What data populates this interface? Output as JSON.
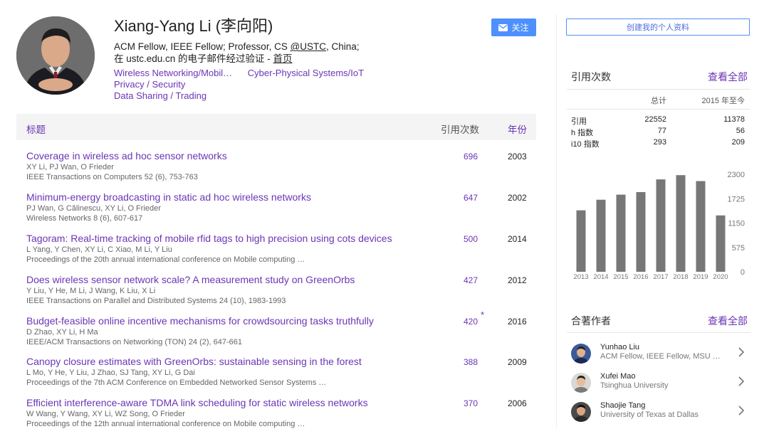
{
  "profile": {
    "name": "Xiang-Yang Li (李向阳)",
    "affiliation_prefix": "ACM Fellow, IEEE Fellow; Professor, CS ",
    "affiliation_org": "@USTC",
    "affiliation_suffix": ", China;",
    "verified_text": "在 ustc.edu.cn 的电子邮件经过验证 - ",
    "homepage_label": "首页",
    "interests": [
      "Wireless Networking/Mobil…",
      "Cyber-Physical Systems/IoT",
      "Privacy / Security",
      "Data Sharing / Trading"
    ]
  },
  "follow_label": "关注",
  "create_profile_label": "创建我的个人资料",
  "table": {
    "header_title": "标题",
    "header_cites": "引用次数",
    "header_year": "年份",
    "articles": [
      {
        "title": "Coverage in wireless ad hoc sensor networks",
        "authors": "XY Li, PJ Wan, O Frieder",
        "venue": "IEEE Transactions on Computers 52 (6), 753-763",
        "cites": "696",
        "star": "",
        "year": "2003"
      },
      {
        "title": "Minimum-energy broadcasting in static ad hoc wireless networks",
        "authors": "PJ Wan, G Călinescu, XY Li, O Frieder",
        "venue": "Wireless Networks 8 (6), 607-617",
        "cites": "647",
        "star": "",
        "year": "2002"
      },
      {
        "title": "Tagoram: Real-time tracking of mobile rfid tags to high precision using cots devices",
        "authors": "L Yang, Y Chen, XY Li, C Xiao, M Li, Y Liu",
        "venue": "Proceedings of the 20th annual international conference on Mobile computing …",
        "cites": "500",
        "star": "",
        "year": "2014"
      },
      {
        "title": "Does wireless sensor network scale? A measurement study on GreenOrbs",
        "authors": "Y Liu, Y He, M Li, J Wang, K Liu, X Li",
        "venue": "IEEE Transactions on Parallel and Distributed Systems 24 (10), 1983-1993",
        "cites": "427",
        "star": "",
        "year": "2012"
      },
      {
        "title": "Budget-feasible online incentive mechanisms for crowdsourcing tasks truthfully",
        "authors": "D Zhao, XY Li, H Ma",
        "venue": "IEEE/ACM Transactions on Networking (TON) 24 (2), 647-661",
        "cites": "420",
        "star": "*",
        "year": "2016"
      },
      {
        "title": "Canopy closure estimates with GreenOrbs: sustainable sensing in the forest",
        "authors": "L Mo, Y He, Y Liu, J Zhao, SJ Tang, XY Li, G Dai",
        "venue": "Proceedings of the 7th ACM Conference on Embedded Networked Sensor Systems …",
        "cites": "388",
        "star": "",
        "year": "2009"
      },
      {
        "title": "Efficient interference-aware TDMA link scheduling for static wireless networks",
        "authors": "W Wang, Y Wang, XY Li, WZ Song, O Frieder",
        "venue": "Proceedings of the 12th annual international conference on Mobile computing …",
        "cites": "370",
        "star": "",
        "year": "2006"
      }
    ]
  },
  "citations": {
    "title": "引用次数",
    "view_all": "查看全部",
    "col_all": "总计",
    "col_since": "2015 年至今",
    "rows": [
      {
        "label": "引用",
        "all": "22552",
        "since": "11378"
      },
      {
        "label": "h 指数",
        "all": "77",
        "since": "56"
      },
      {
        "label": "i10 指数",
        "all": "293",
        "since": "209"
      }
    ]
  },
  "chart_data": {
    "type": "bar",
    "categories": [
      "2013",
      "2014",
      "2015",
      "2016",
      "2017",
      "2018",
      "2019",
      "2020"
    ],
    "values": [
      1450,
      1700,
      1820,
      1880,
      2180,
      2280,
      2140,
      1330
    ],
    "ylim": [
      0,
      2300
    ],
    "yticks": [
      "0",
      "575",
      "1150",
      "1725",
      "2300"
    ],
    "bar_color": "#777777",
    "axis_position": "right"
  },
  "coauthors": {
    "title": "合著作者",
    "view_all": "查看全部",
    "items": [
      {
        "name": "Yunhao Liu",
        "affiliation": "ACM Fellow, IEEE Fellow, MSU …"
      },
      {
        "name": "Xufei Mao",
        "affiliation": "Tsinghua University"
      },
      {
        "name": "Shaojie Tang",
        "affiliation": "University of Texas at Dallas"
      }
    ]
  },
  "colors": {
    "accent": "#6b35b5",
    "button": "#4d90fe"
  }
}
